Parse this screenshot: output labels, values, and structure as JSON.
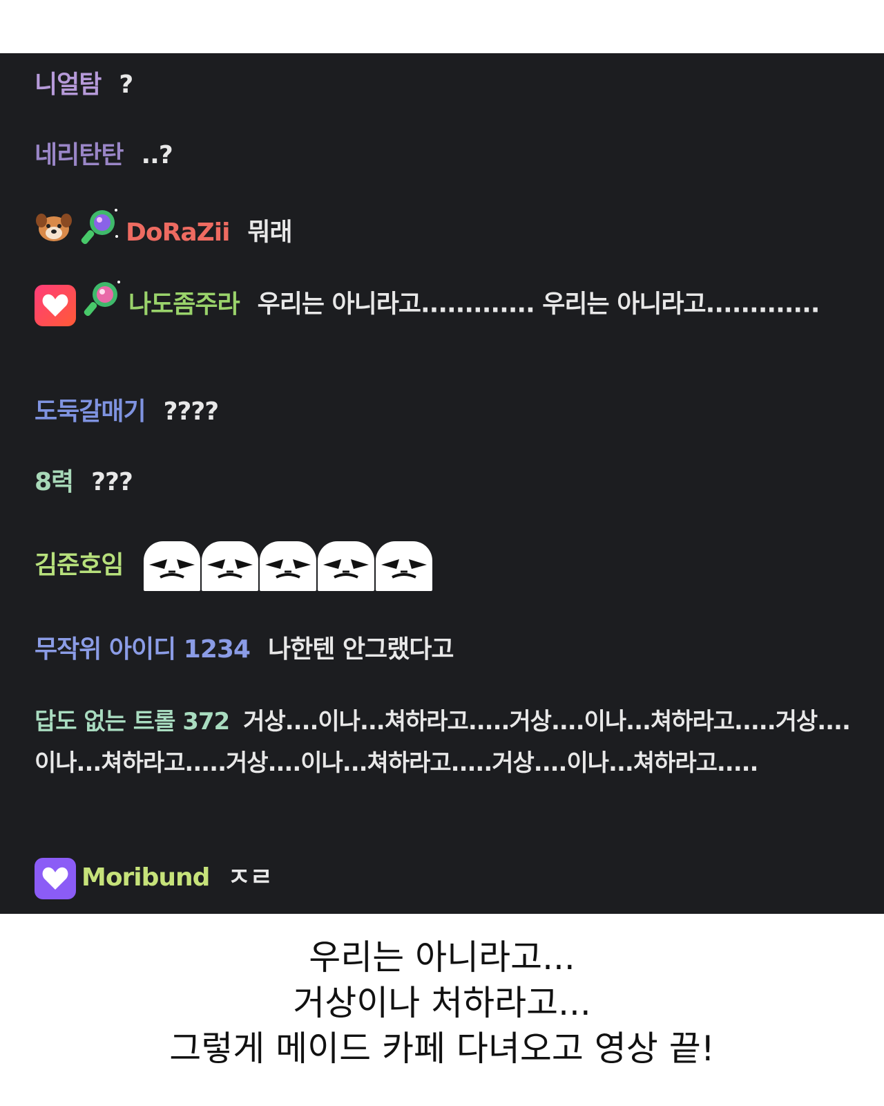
{
  "chat": {
    "messages": [
      {
        "user": "니얼탐",
        "text": "?",
        "user_color": "#b69ad9"
      },
      {
        "user": "네리탄탄",
        "text": "..?",
        "user_color": "#9a86c7"
      },
      {
        "user": "DoRaZii",
        "text": "뭐래",
        "user_color": "#ee6b61",
        "badges": [
          "dog-icon",
          "magnifier-gem-icon"
        ]
      },
      {
        "user": "나도좀주라",
        "text": "우리는 아니라고............. 우리는 아니라고.............",
        "user_color": "#9ad36b",
        "badges": [
          "heart-badge-icon",
          "magnifier-gem-icon"
        ],
        "badge_color": "#ff3d7a"
      },
      {
        "user": "도둑갈매기",
        "text": "????",
        "user_color": "#7f93e0"
      },
      {
        "user": "8력",
        "text": "???",
        "user_color": "#a8d8b8"
      },
      {
        "user": "김준호임",
        "text": "",
        "user_color": "#b7e07c",
        "emotes": [
          "pepe-face-emote",
          "pepe-face-emote",
          "pepe-face-emote",
          "pepe-face-emote",
          "pepe-face-emote"
        ]
      },
      {
        "user": "무작위 아이디 1234",
        "text": "나한텐 안그랬다고",
        "user_color": "#8b9ce6"
      },
      {
        "user": "답도 없는 트롤 372",
        "text": "거상....이나...쳐하라고.....거상....이나...쳐하라고.....거상....이나...쳐하라고.....거상....이나...쳐하라고.....거상....이나...쳐하라고.....",
        "user_color": "#a9dcc0"
      },
      {
        "user": "Moribund",
        "text": "ㅈㄹ",
        "user_color": "#c6e27a",
        "badges": [
          "heart-badge-icon"
        ],
        "badge_color": "#8b5cf6"
      }
    ]
  },
  "caption": {
    "line1": "우리는 아니라고...",
    "line2": "거상이나 처하라고...",
    "line3": "그렇게 메이드 카페 다녀오고 영상 끝!"
  }
}
